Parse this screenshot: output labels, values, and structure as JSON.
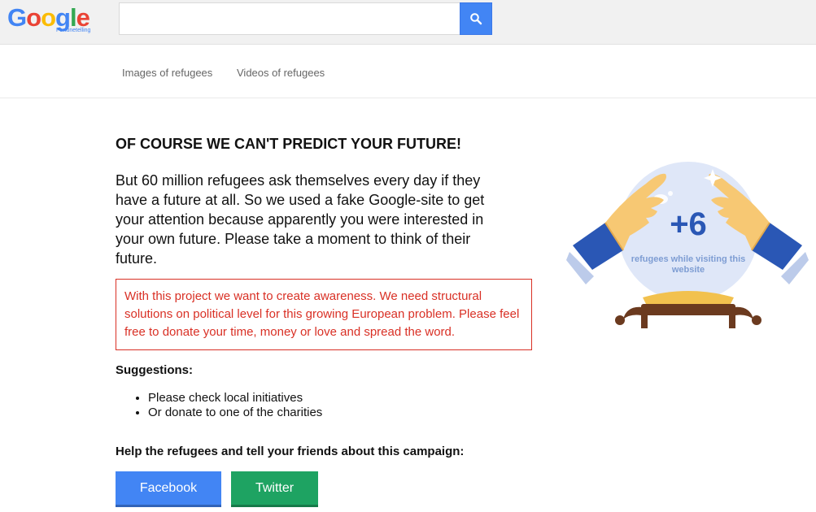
{
  "header": {
    "logo_text": "Google",
    "logo_subtitle": "Fortunetelling",
    "search": {
      "value": "",
      "placeholder": ""
    },
    "search_icon": "search-icon"
  },
  "nav": {
    "images_label": "Images of refugees",
    "videos_label": "Videos of refugees"
  },
  "main": {
    "headline": "OF COURSE WE CAN'T PREDICT YOUR FUTURE!",
    "lead": "But 60 million refugees ask themselves every day if they have a future at all. So we used a fake Google-site to get your attention because apparently you were interested in your own future. Please take a moment to think of their future.",
    "notice": "With this project we want to create awareness. We need structural solutions on political level for this growing European problem. Please feel free to donate your time, money or love and spread the word.",
    "suggestions_title": "Suggestions:",
    "suggestions": [
      "Please check local initiatives",
      "Or donate to one of the charities"
    ],
    "cta": "Help the refugees and tell your friends about this campaign:",
    "facebook_label": "Facebook",
    "twitter_label": "Twitter"
  },
  "illustration": {
    "counter": "+6",
    "counter_label": "refugees while visiting this website"
  },
  "colors": {
    "facebook": "#4285f4",
    "twitter": "#1ea362",
    "notice": "#d93025",
    "counter": "#2a57b5"
  }
}
